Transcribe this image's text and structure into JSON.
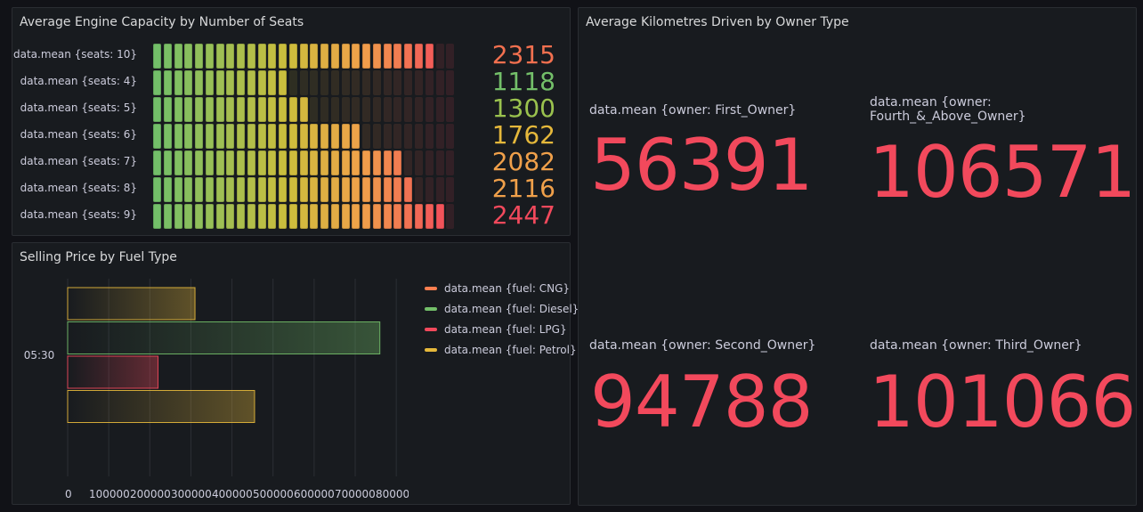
{
  "panels": {
    "engine": {
      "title": "Average Engine Capacity by Number of Seats",
      "rows": [
        {
          "label": "data.mean {seats: 10}",
          "value": "2315",
          "numeric": 2315,
          "color": "#f2704f"
        },
        {
          "label": "data.mean {seats: 4}",
          "value": "1118",
          "numeric": 1118,
          "color": "#73bf69"
        },
        {
          "label": "data.mean {seats: 5}",
          "value": "1300",
          "numeric": 1300,
          "color": "#9ac24e"
        },
        {
          "label": "data.mean {seats: 6}",
          "value": "1762",
          "numeric": 1762,
          "color": "#e5b83b"
        },
        {
          "label": "data.mean {seats: 7}",
          "value": "2082",
          "numeric": 2082,
          "color": "#f0a04a"
        },
        {
          "label": "data.mean {seats: 8}",
          "value": "2116",
          "numeric": 2116,
          "color": "#f0a04a"
        },
        {
          "label": "data.mean {seats: 9}",
          "value": "2447",
          "numeric": 2447,
          "color": "#f2495c"
        }
      ]
    },
    "price": {
      "title": "Selling Price by Fuel Type",
      "time_label": "05:30",
      "x_ticks": [
        "0",
        "100000",
        "200000",
        "300000",
        "400000",
        "500000",
        "600000",
        "700000",
        "800000"
      ]
    },
    "km": {
      "title": "Average Kilometres Driven by Owner Type",
      "stats": [
        {
          "label": "data.mean {owner: First_Owner}",
          "value": "56391"
        },
        {
          "label": "data.mean {owner: Fourth_&_Above_Owner}",
          "value": "106571"
        },
        {
          "label": "data.mean {owner: Second_Owner}",
          "value": "94788"
        },
        {
          "label": "data.mean {owner: Third_Owner}",
          "value": "101066"
        }
      ]
    }
  },
  "chart_data": {
    "type": "bar",
    "orientation": "horizontal",
    "categories": [
      "05:30"
    ],
    "series": [
      {
        "name": "data.mean {fuel: CNG}",
        "values": [
          310000
        ],
        "color": "#e5b83b",
        "legend_color": "#ff7f50"
      },
      {
        "name": "data.mean {fuel: Diesel}",
        "values": [
          760000
        ],
        "color": "#73bf69",
        "legend_color": "#73bf69"
      },
      {
        "name": "data.mean {fuel: LPG}",
        "values": [
          220000
        ],
        "color": "#f2495c",
        "legend_color": "#f2495c"
      },
      {
        "name": "data.mean {fuel: Petrol}",
        "values": [
          455000
        ],
        "color": "#e5b83b",
        "legend_color": "#e5b83b"
      }
    ],
    "xlim": [
      0,
      830000
    ],
    "grid": true,
    "legend": "right"
  }
}
